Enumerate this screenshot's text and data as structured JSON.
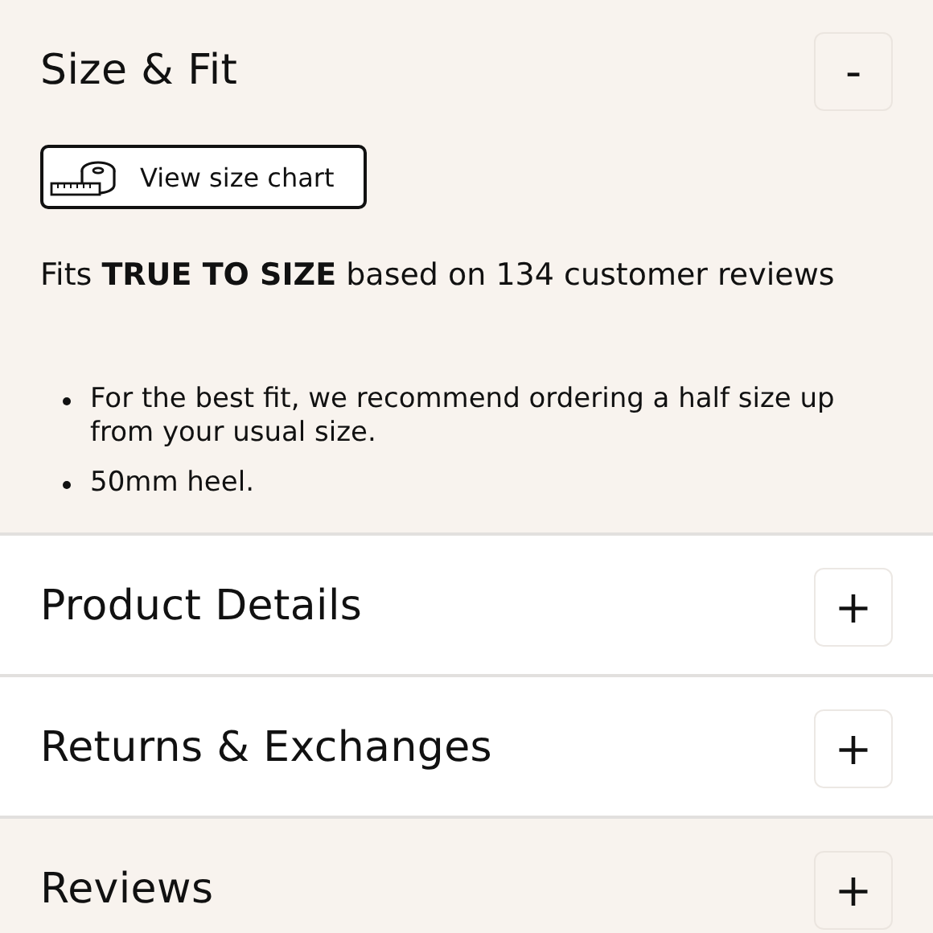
{
  "sections": [
    {
      "title": "Size & Fit",
      "toggle": "-",
      "shaded": true,
      "size_chart_button": "View size chart",
      "fit_summary": "Fits **TRUE TO SIZE** based on 134 customer reviews",
      "bullets": [
        "For the best fit, we recommend ordering a half size up from your usual size.",
        "50mm heel."
      ]
    },
    {
      "title": "Product Details",
      "toggle": "+",
      "shaded": false
    },
    {
      "title": "Returns & Exchanges",
      "toggle": "+",
      "shaded": false
    },
    {
      "title": "Reviews",
      "toggle": "+",
      "shaded": true
    }
  ]
}
